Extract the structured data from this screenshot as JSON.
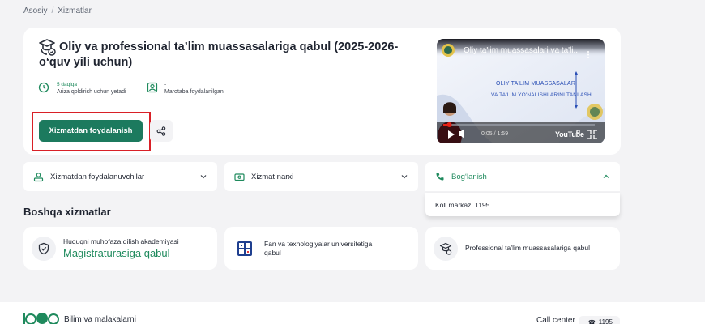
{
  "breadcrumb": {
    "home": "Asosiy",
    "separator": "/",
    "current": "Xizmatlar"
  },
  "service": {
    "title": "Oliy va professional ta’lim muassasalariga qabul (2025-2026-o‘quv yili uchun)",
    "duration_value": "5 daqiqa",
    "duration_label": "Ariza qoldirish uchun yetadi",
    "users_value": "-",
    "users_label": "Marotaba foydalanilgan",
    "use_button": "Xizmatdan foydalanish"
  },
  "video": {
    "title": "Oliy ta'lim muassasalari va ta'li...",
    "slide_line1": "OLIY TA'LIM MUASSASALARI",
    "slide_line2": "VA TA'LIM YO'NALISHLARINI TANLASH",
    "time": "0:05 / 1:59",
    "brand": "YouTube",
    "progress": 0.04
  },
  "accordions": {
    "users": "Xizmatdan foydalanuvchilar",
    "price": "Xizmat narxi",
    "contact": "Bog‘lanish",
    "contact_value": "Koll markaz: 1195"
  },
  "other": {
    "title": "Boshqa xizmatlar",
    "items": [
      {
        "line1": "Huquqni muhofaza qilish akademiyasi",
        "line2": "Magistraturasiga qabul"
      },
      {
        "line1": "Fan va texnologiyalar universitetiga",
        "line2": "qabul"
      },
      {
        "line1": "Professional ta’lim muassasalariga qabul"
      }
    ]
  },
  "footer": {
    "brand_text": "Bilim va malakalarni",
    "call_center": "Call center",
    "phone": "1195"
  },
  "colors": {
    "primary": "#1c7a5e",
    "accent_green": "#1f8a5d",
    "highlight": "#d92027"
  }
}
